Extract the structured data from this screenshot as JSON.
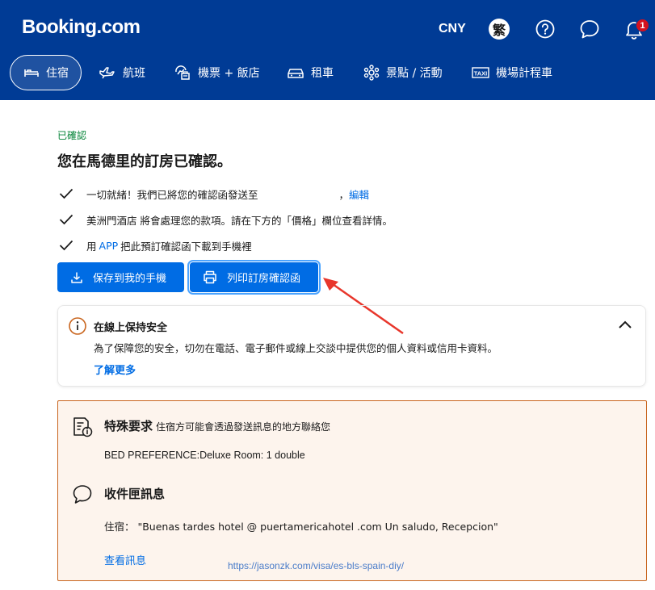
{
  "header": {
    "logo": "Booking.com",
    "currency": "CNY",
    "language": "繁",
    "notification_count": "1",
    "colors": {
      "header_bg": "#003b95",
      "accent": "#006ce4",
      "badge": "#d4111e"
    }
  },
  "nav": {
    "items": [
      {
        "label": "住宿",
        "icon": "bed-icon",
        "active": true
      },
      {
        "label": "航班",
        "icon": "plane-icon"
      },
      {
        "label": "機票 + 飯店",
        "icon": "flight-hotel-icon"
      },
      {
        "label": "租車",
        "icon": "car-icon"
      },
      {
        "label": "景點 / 活動",
        "icon": "attractions-icon"
      },
      {
        "label": "機場計程車",
        "icon": "taxi-icon"
      }
    ]
  },
  "confirmation": {
    "status": "已確認",
    "title": "您在馬德里的訂房已確認。",
    "checks": [
      {
        "text": "一切就緒！我們已將您的確認函發送至",
        "suffix": "，",
        "link": "編輯"
      },
      {
        "text": "美洲門酒店 將會處理您的款項。請在下方的「價格」欄位查看詳情。"
      },
      {
        "prefix": "用 ",
        "link": "APP",
        "text": " 把此預訂確認函下載到手機裡"
      }
    ],
    "buttons": {
      "save": "保存到我的手機",
      "print": "列印訂房確認函"
    }
  },
  "safety": {
    "title": "在線上保持安全",
    "text": "為了保障您的安全，切勿在電話、電子郵件或線上交談中提供您的個人資料或信用卡資料。",
    "link": "了解更多"
  },
  "special_request": {
    "title": "特殊要求",
    "subtitle": "住宿方可能會透過發送訊息的地方聯絡您",
    "value": "BED PREFERENCE:Deluxe Room: 1 double"
  },
  "inbox": {
    "title": "收件匣訊息",
    "message": "住宿：  \"Buenas tardes hotel @ puertamericahotel .com Un saludo, Recepcion\"",
    "link": "查看訊息"
  },
  "watermark": "https://jasonzk.com/visa/es-bls-spain-diy/"
}
